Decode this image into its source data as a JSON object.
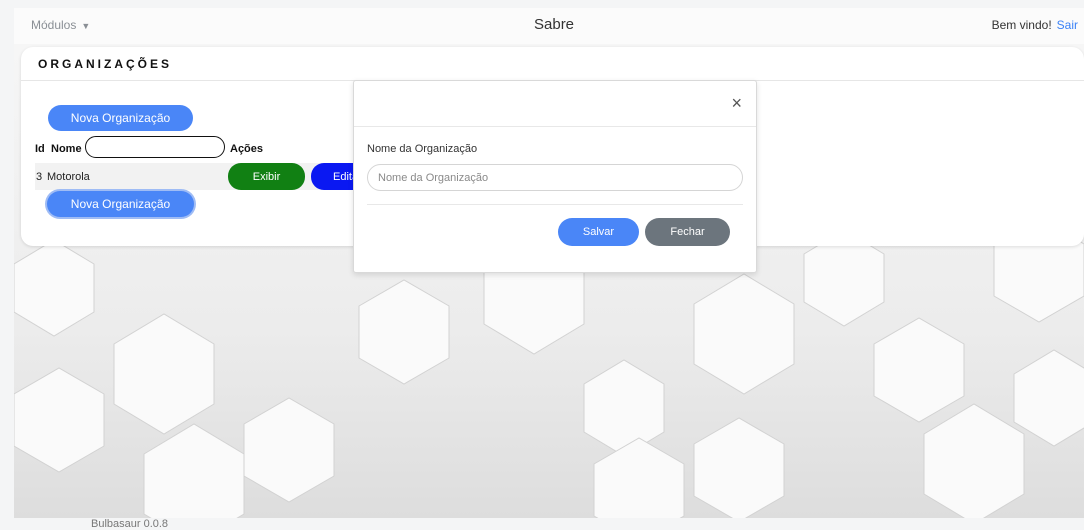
{
  "navbar": {
    "modules_label": "Módulos",
    "caret_glyph": "▼",
    "brand": "Sabre",
    "welcome": "Bem vindo!",
    "logout": "Sair"
  },
  "card": {
    "title": "ORGANIZAÇÕES",
    "new_button_top": "Nova Organização",
    "new_button_bottom": "Nova Organização",
    "table": {
      "headers": {
        "id": "Id",
        "name": "Nome",
        "actions": "Ações"
      },
      "rows": [
        {
          "id": "3",
          "name": "Motorola",
          "view": "Exibir",
          "edit": "Editar"
        }
      ]
    }
  },
  "modal": {
    "close_glyph": "×",
    "field_label": "Nome da Organização",
    "field_placeholder": "Nome da Organização",
    "save": "Salvar",
    "close": "Fechar"
  },
  "footer": {
    "version": "Bulbasaur 0.0.8"
  },
  "colors": {
    "primary": "#4a86f7",
    "success": "#118013",
    "edit": "#0a18f2",
    "secondary": "#6c757d",
    "link": "#3b82f6"
  }
}
